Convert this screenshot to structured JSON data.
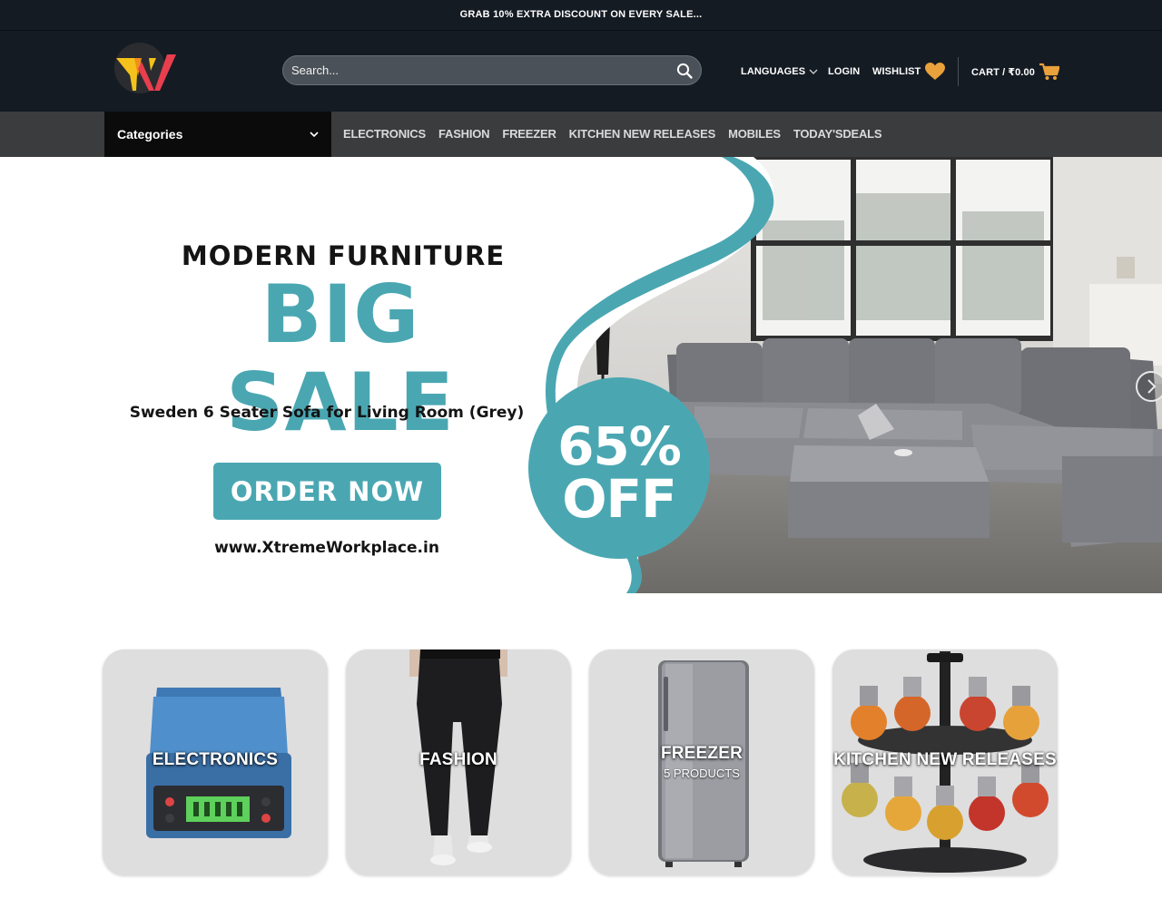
{
  "topbar": {
    "promo_text": "GRAB 10% EXTRA DISCOUNT ON EVERY SALE..."
  },
  "header": {
    "search": {
      "placeholder": "Search..."
    },
    "nav": {
      "languages": "LANGUAGES",
      "login": "LOGIN",
      "wishlist": "WISHLIST",
      "cart": "CART / ₹0.00"
    }
  },
  "category_nav": {
    "dropdown_label": "Categories",
    "links": [
      "ELECTRONICS",
      "FASHION",
      "FREEZER",
      "KITCHEN NEW RELEASES",
      "MOBILES",
      "TODAY'SDEALS"
    ]
  },
  "hero": {
    "kicker": "MODERN FURNITURE",
    "title": "BIG SALE",
    "subtitle": "Sweden 6 Seater Sofa for Living Room (Grey)",
    "button": "ORDER NOW",
    "url": "www.XtremeWorkplace.in",
    "badge_line1": "65%",
    "badge_line2": "OFF",
    "accent_color": "#4aa7b2"
  },
  "category_cards": [
    {
      "label": "ELECTRONICS",
      "count": ""
    },
    {
      "label": "FASHION",
      "count": ""
    },
    {
      "label": "FREEZER",
      "count": "5 PRODUCTS"
    },
    {
      "label": "KITCHEN NEW RELEASES",
      "count": ""
    }
  ],
  "colors": {
    "header_bg": "#151b23",
    "nav_bg": "#3b3c3e",
    "icon_orange": "#e8a13b"
  }
}
